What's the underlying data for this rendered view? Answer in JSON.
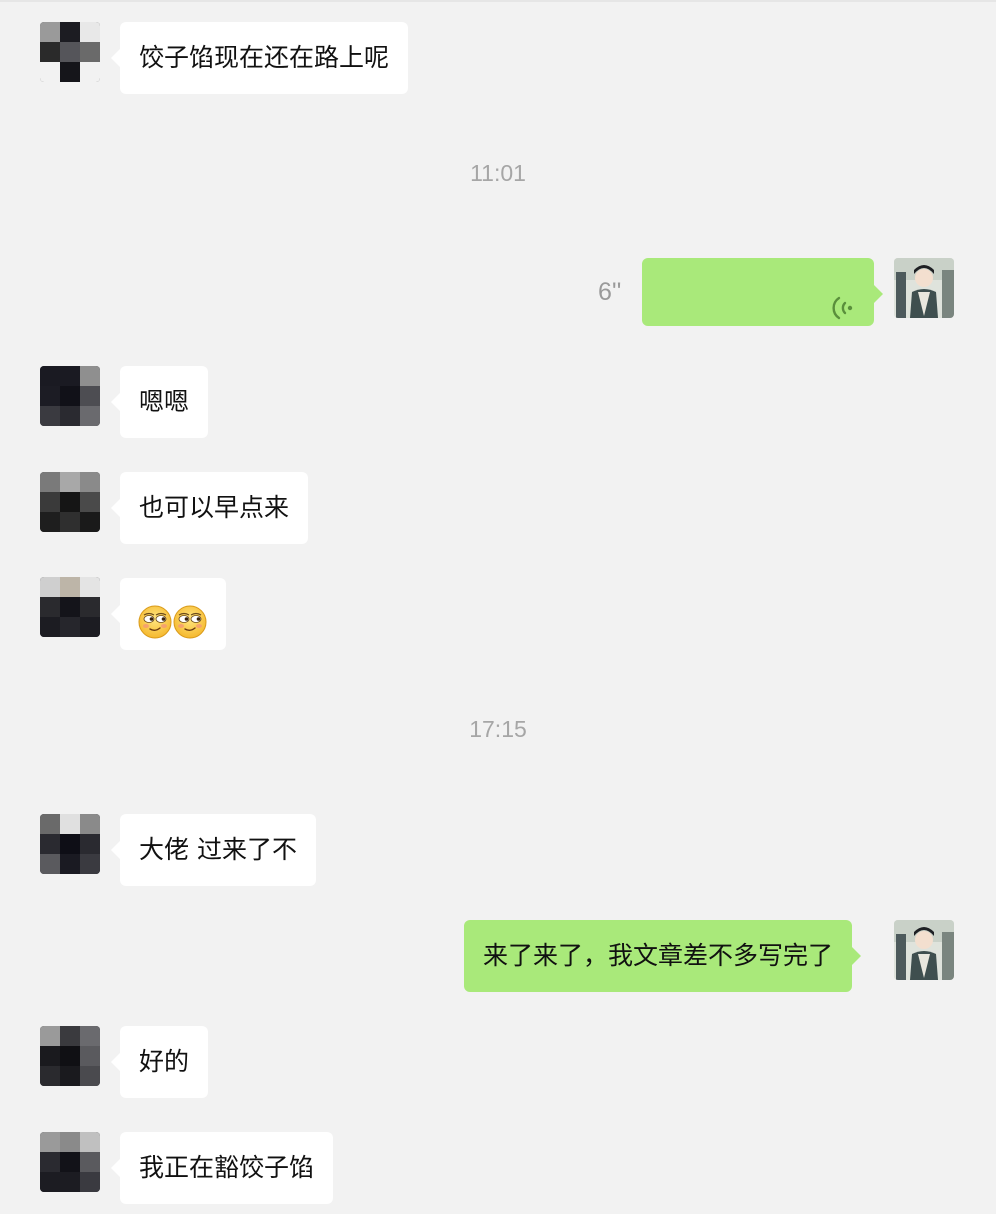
{
  "timestamps": [
    "11:01",
    "17:15"
  ],
  "voice_message": {
    "duration": "6''",
    "icon": "voice-wave-icon"
  },
  "messages": [
    {
      "sender": "contact",
      "text": "饺子馅现在还在路上呢"
    },
    {
      "sender": "me",
      "type": "voice",
      "duration": "6''"
    },
    {
      "sender": "contact",
      "text": "嗯嗯"
    },
    {
      "sender": "contact",
      "text": "也可以早点来"
    },
    {
      "sender": "contact",
      "type": "emoji",
      "emoji": "smirk-emoji",
      "count": 2
    },
    {
      "sender": "contact",
      "text": "大佬 过来了不"
    },
    {
      "sender": "me",
      "text": "来了来了，我文章差不多写完了"
    },
    {
      "sender": "contact",
      "text": "好的"
    },
    {
      "sender": "contact",
      "text": "我正在豁饺子馅"
    }
  ],
  "colors": {
    "background": "#f2f2f2",
    "incoming_bubble": "#ffffff",
    "outgoing_bubble": "#a9e97a",
    "timestamp_text": "#a6a6a6"
  }
}
